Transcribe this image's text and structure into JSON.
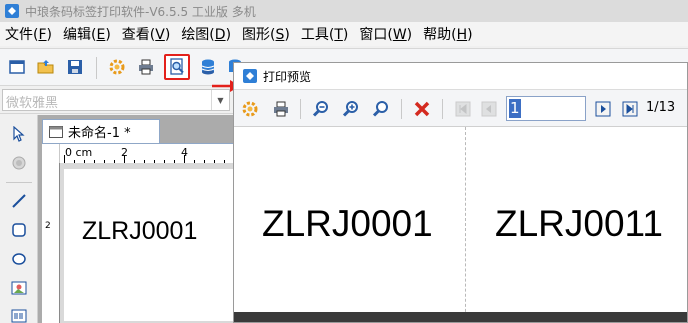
{
  "window": {
    "title": "中琅条码标签打印软件-V6.5.5 工业版 多机"
  },
  "menu": [
    {
      "label": "文件(",
      "key": "F",
      "end": ")"
    },
    {
      "label": "编辑(",
      "key": "E",
      "end": ")"
    },
    {
      "label": "查看(",
      "key": "V",
      "end": ")"
    },
    {
      "label": "绘图(",
      "key": "D",
      "end": ")"
    },
    {
      "label": "图形(",
      "key": "S",
      "end": ")"
    },
    {
      "label": "工具(",
      "key": "T",
      "end": ")"
    },
    {
      "label": "窗口(",
      "key": "W",
      "end": ")"
    },
    {
      "label": "帮助(",
      "key": "H",
      "end": ")"
    }
  ],
  "font_selector": {
    "value": "微软雅黑"
  },
  "document": {
    "tab_name": "未命名-1 *",
    "ruler_labels": [
      "0 cm",
      "2",
      "4"
    ],
    "vruler_labels": [
      "2"
    ],
    "label_text": "ZLRJ0001"
  },
  "preview": {
    "title": "打印预览",
    "page_value": "1",
    "page_total": "1/13",
    "labels": [
      "ZLRJ0001",
      "ZLRJ0011"
    ]
  },
  "colors": {
    "highlight": "#e3201b",
    "arrow": "#e3201b",
    "accent": "#3d6fc4"
  }
}
